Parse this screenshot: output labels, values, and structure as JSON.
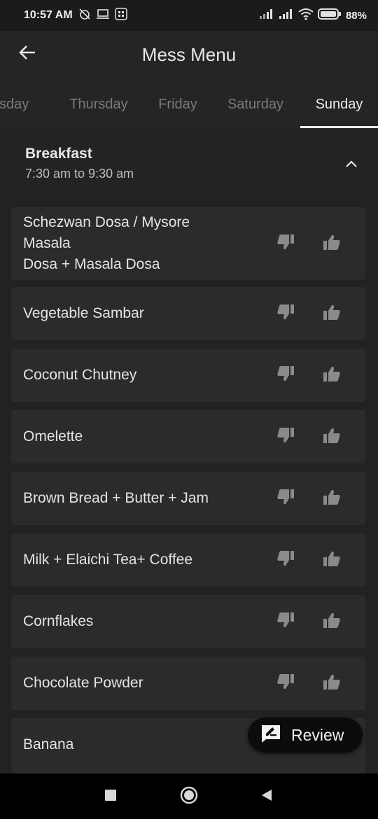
{
  "status_bar": {
    "time": "10:57 AM",
    "battery": "88%"
  },
  "app_bar": {
    "title": "Mess Menu",
    "back_icon": "arrow-left-icon"
  },
  "tabs": [
    {
      "label": "Wednesday",
      "visible_text": "nesday",
      "active": false
    },
    {
      "label": "Thursday",
      "active": false
    },
    {
      "label": "Friday",
      "active": false
    },
    {
      "label": "Saturday",
      "active": false
    },
    {
      "label": "Sunday",
      "active": true
    }
  ],
  "section": {
    "title": "Breakfast",
    "time": "7:30 am to 9:30 am",
    "expanded": true
  },
  "menu_items": [
    {
      "name_lines": [
        "Schezwan Dosa / Mysore",
        "Masala",
        "Dosa + Masala Dosa"
      ]
    },
    {
      "name_lines": [
        "Vegetable Sambar"
      ]
    },
    {
      "name_lines": [
        "Coconut Chutney"
      ]
    },
    {
      "name_lines": [
        "Omelette"
      ]
    },
    {
      "name_lines": [
        "Brown Bread + Butter + Jam"
      ]
    },
    {
      "name_lines": [
        "Milk + Elaichi Tea+ Coffee"
      ]
    },
    {
      "name_lines": [
        "Cornflakes"
      ]
    },
    {
      "name_lines": [
        "Chocolate Powder"
      ]
    },
    {
      "name_lines": [
        "Banana"
      ]
    }
  ],
  "review_button": {
    "label": "Review"
  },
  "colors": {
    "background": "#222222",
    "card": "#2b2b2b",
    "icon_grey": "#8a8a8a",
    "active_tab": "#ececec",
    "inactive_tab": "#7a7a7a"
  }
}
